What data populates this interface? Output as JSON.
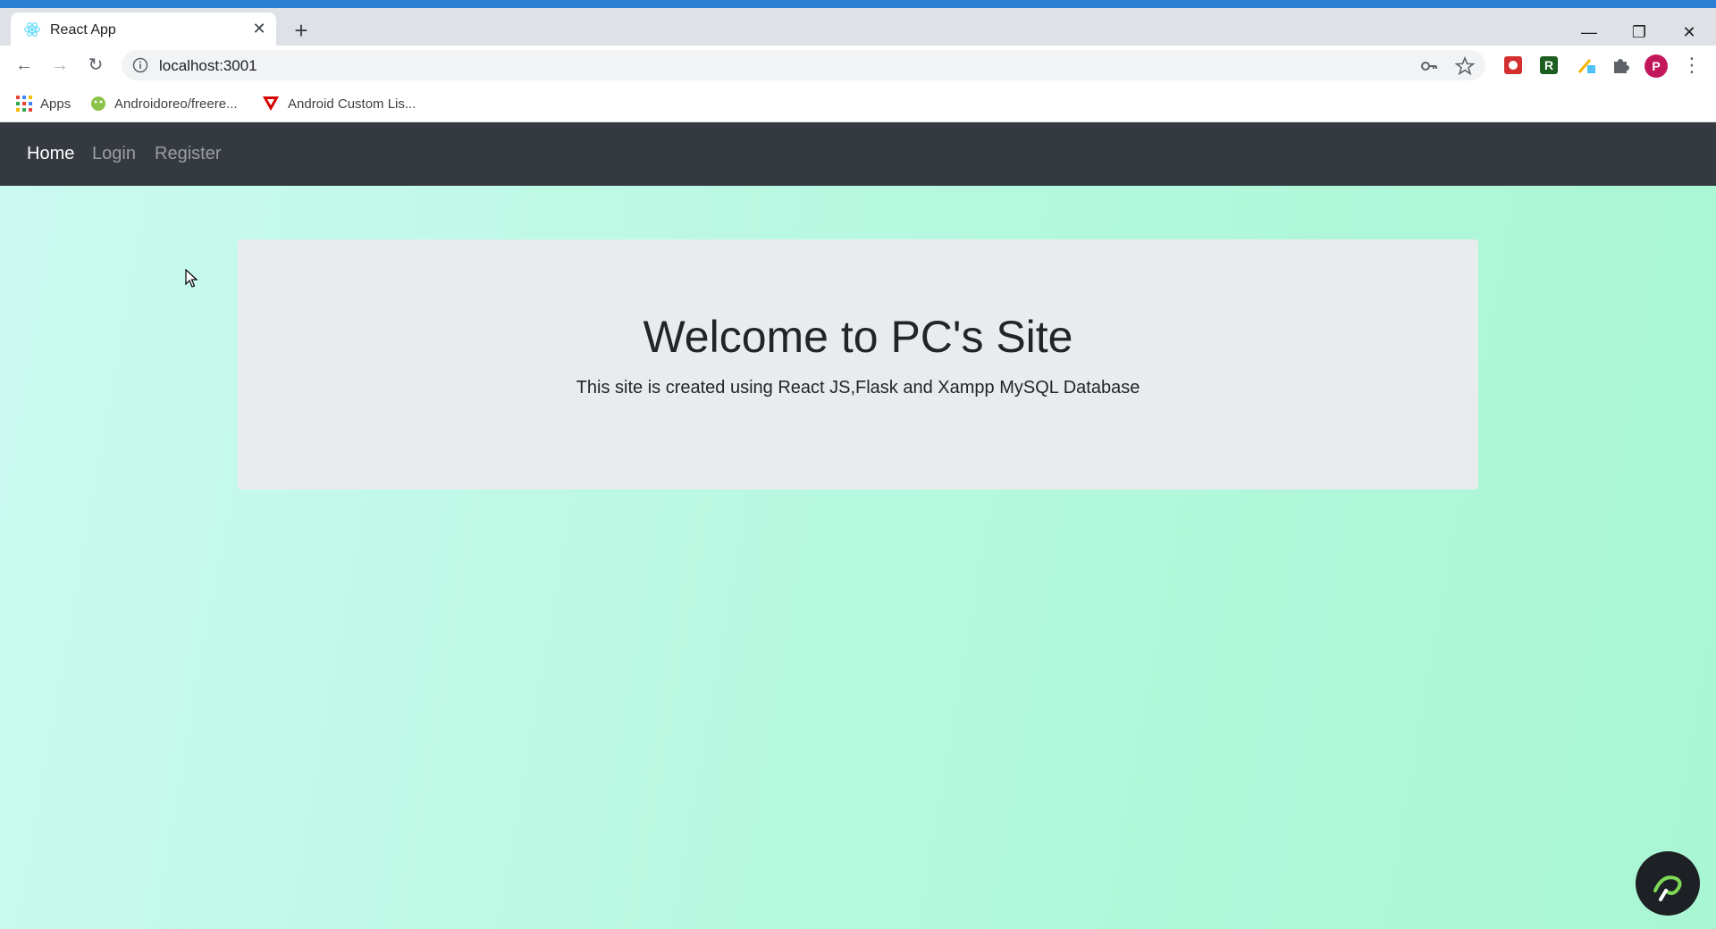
{
  "browser": {
    "tab": {
      "title": "React App",
      "favicon": "react-icon"
    },
    "url": "localhost:3001",
    "bookmarks": [
      {
        "label": "Apps",
        "icon": "apps-grid-icon"
      },
      {
        "label": "Androidoreo/freere...",
        "icon": "android-icon"
      },
      {
        "label": "Android Custom Lis...",
        "icon": "red-v-icon"
      }
    ],
    "profile_initial": "P",
    "window_controls": {
      "minimize": "—",
      "maximize": "❐",
      "close": "✕"
    }
  },
  "navbar": {
    "links": [
      {
        "label": "Home",
        "active": true
      },
      {
        "label": "Login",
        "active": false
      },
      {
        "label": "Register",
        "active": false
      }
    ]
  },
  "jumbotron": {
    "title": "Welcome to PC's Site",
    "text": "This site is created using React JS,Flask and Xampp MySQL Database"
  },
  "colors": {
    "navbar": "#343a40",
    "jumbotron": "#e9ecef",
    "page_gradient_start": "#cbfaf0",
    "page_gradient_end": "#a9f6d4",
    "profile": "#c2185b"
  }
}
